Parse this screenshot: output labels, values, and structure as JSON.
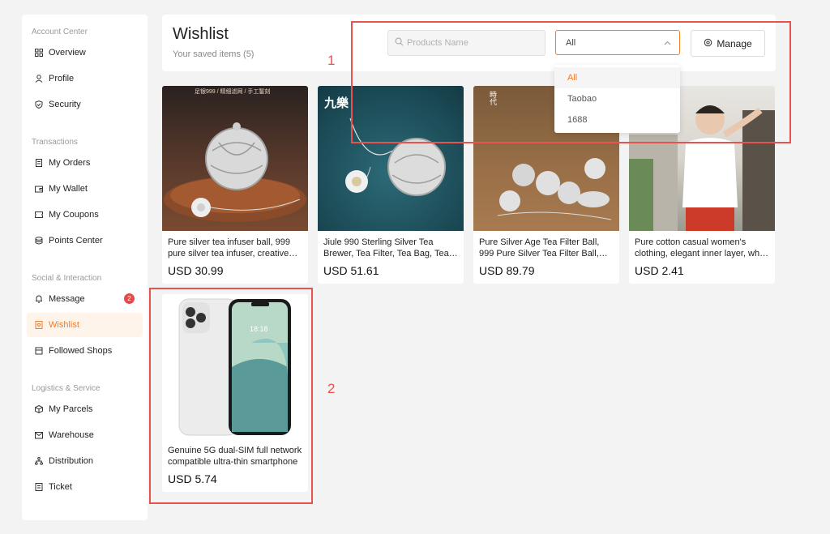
{
  "sidebar": {
    "sections": [
      {
        "title": "Account Center",
        "items": [
          {
            "label": "Overview",
            "icon": "grid-icon"
          },
          {
            "label": "Profile",
            "icon": "user-icon"
          },
          {
            "label": "Security",
            "icon": "shield-icon"
          }
        ]
      },
      {
        "title": "Transactions",
        "items": [
          {
            "label": "My Orders",
            "icon": "document-icon"
          },
          {
            "label": "My Wallet",
            "icon": "wallet-icon"
          },
          {
            "label": "My Coupons",
            "icon": "coupon-icon"
          },
          {
            "label": "Points Center",
            "icon": "coins-icon"
          }
        ]
      },
      {
        "title": "Social & Interaction",
        "items": [
          {
            "label": "Message",
            "icon": "bell-icon",
            "badge": "2"
          },
          {
            "label": "Wishlist",
            "icon": "wishlist-icon",
            "active": true
          },
          {
            "label": "Followed Shops",
            "icon": "shop-icon"
          }
        ]
      },
      {
        "title": "Logistics & Service",
        "items": [
          {
            "label": "My Parcels",
            "icon": "box-icon"
          },
          {
            "label": "Warehouse",
            "icon": "warehouse-icon"
          },
          {
            "label": "Distribution",
            "icon": "hierarchy-icon"
          },
          {
            "label": "Ticket",
            "icon": "ticket-icon"
          }
        ]
      }
    ]
  },
  "header": {
    "title": "Wishlist",
    "subtitle": "Your saved items (5)",
    "search_placeholder": "Products Name",
    "select_value": "All",
    "manage_label": "Manage"
  },
  "dropdown": {
    "options": [
      "All",
      "Taobao",
      "1688"
    ],
    "selected": "All"
  },
  "products": [
    {
      "name": "Pure silver tea infuser ball, 999 pure silver tea infuser, creative handmade",
      "price": "USD 30.99",
      "image": "silver-tea-ball-image",
      "overlay_text": "足银999 / 精细滤网 / 手工錾刻"
    },
    {
      "name": "Jiule 990 Sterling Silver Tea Brewer, Tea Filter, Tea Bag, Tea Leaf Filter",
      "price": "USD 51.61",
      "image": "silver-tea-brewer-image",
      "overlay_text": "九樂"
    },
    {
      "name": "Pure Silver Age Tea Filter Ball, 999 Pure Silver Tea Filter Ball, Tea Strainer",
      "price": "USD 89.79",
      "image": "silver-filter-balls-image",
      "overlay_text": "時代"
    },
    {
      "name": "Pure cotton casual women's clothing, elegant inner layer, white T-shirt",
      "price": "USD 2.41",
      "image": "white-tshirt-woman-image"
    },
    {
      "name": "Genuine 5G dual-SIM full network compatible ultra-thin smartphone",
      "price": "USD 5.74",
      "image": "smartphone-image",
      "phone_time": "18:18"
    }
  ],
  "annotations": {
    "label_1": "1",
    "label_2": "2"
  },
  "colors": {
    "accent": "#f07d2a",
    "annotation": "#e8524f",
    "badge": "#e84a4a"
  }
}
